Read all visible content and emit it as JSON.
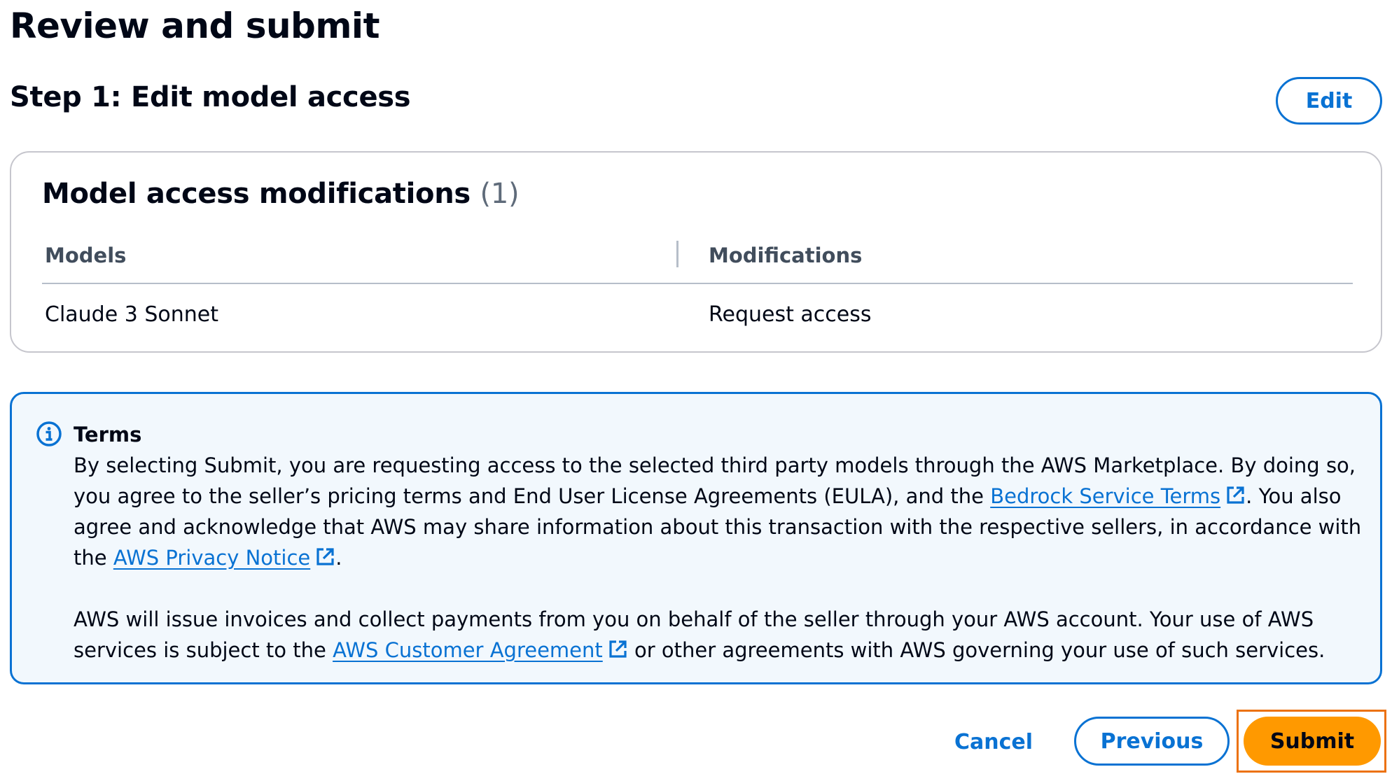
{
  "page": {
    "title": "Review and submit"
  },
  "step": {
    "title": "Step 1: Edit model access",
    "edit_label": "Edit"
  },
  "card": {
    "title": "Model access modifications",
    "count": "(1)",
    "columns": [
      "Models",
      "Modifications"
    ],
    "rows": [
      {
        "model": "Claude 3 Sonnet",
        "modification": "Request access"
      }
    ]
  },
  "terms": {
    "icon": "info-icon",
    "heading": "Terms",
    "p1_a": "By selecting Submit, you are requesting access to the selected third party models through the AWS Marketplace. By doing so, you agree to the seller’s pricing terms and End User License Agreements (EULA), and the ",
    "p1_link1": "Bedrock Service Terms",
    "p1_b": ". You also agree and acknowledge that AWS may share information about this transaction with the respective sellers, in accordance with the ",
    "p1_link2": "AWS Privacy Notice",
    "p1_c": ".",
    "p2_a": "AWS will issue invoices and collect payments from you on behalf of the seller through your AWS account. Your use of AWS services is subject to the ",
    "p2_link": "AWS Customer Agreement",
    "p2_b": " or other agreements with AWS governing your use of such services.",
    "external_icon": "external-link-icon"
  },
  "footer": {
    "cancel_label": "Cancel",
    "previous_label": "Previous",
    "submit_label": "Submit"
  },
  "colors": {
    "primary_blue": "#0972d3",
    "submit_orange": "#ff9900",
    "alert_background": "#f2f8fd",
    "text": "#000716"
  }
}
